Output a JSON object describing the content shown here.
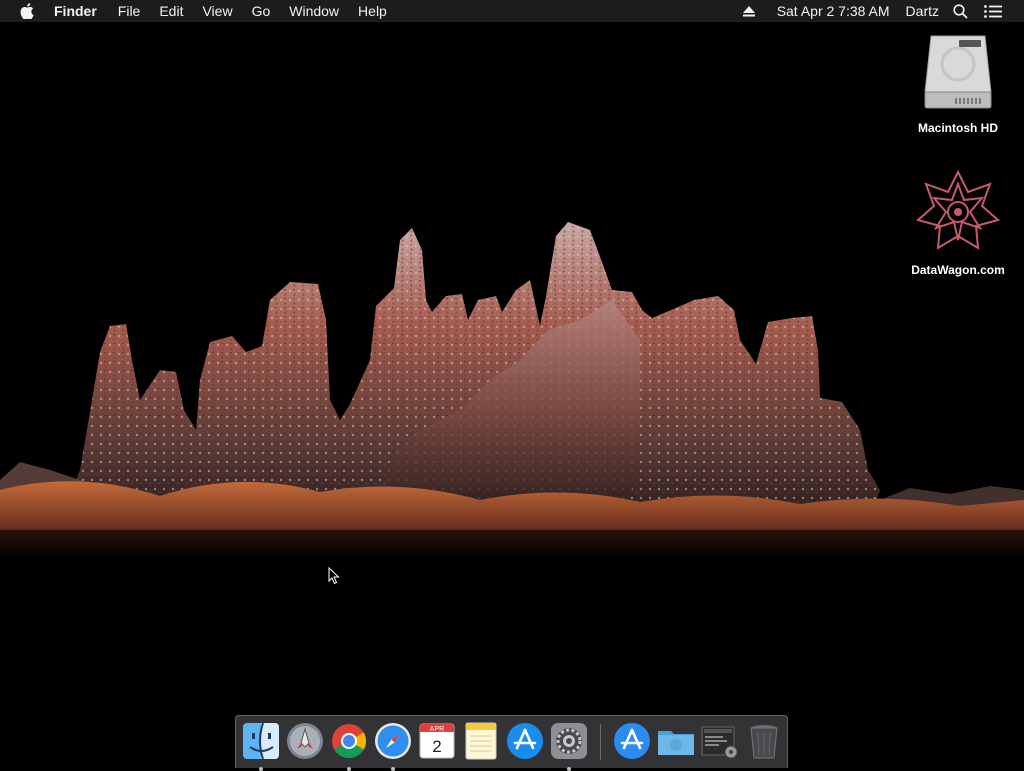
{
  "menubar": {
    "app_name": "Finder",
    "menus": [
      "File",
      "Edit",
      "View",
      "Go",
      "Window",
      "Help"
    ],
    "date_time": "Sat Apr 2  7:38 AM",
    "user": "Dartz",
    "icons": [
      "apple-icon",
      "eject-icon",
      "spotlight-search-icon",
      "notification-center-icon"
    ]
  },
  "desktop": {
    "icons": [
      {
        "label": "Macintosh HD",
        "icon": "hard-drive-icon"
      },
      {
        "label": "DataWagon.com",
        "icon": "datawagon-logo-icon"
      }
    ]
  },
  "dock": {
    "items": [
      {
        "name": "Finder",
        "icon": "finder-icon",
        "running": true
      },
      {
        "name": "Launchpad",
        "icon": "launchpad-icon",
        "running": false
      },
      {
        "name": "Google Chrome",
        "icon": "chrome-icon",
        "running": true
      },
      {
        "name": "Safari",
        "icon": "safari-icon",
        "running": true
      },
      {
        "name": "Calendar",
        "icon": "calendar-icon",
        "running": false,
        "month": "APR",
        "day": "2"
      },
      {
        "name": "Notes",
        "icon": "notes-icon",
        "running": false
      },
      {
        "name": "App Store",
        "icon": "app-store-icon",
        "running": false
      },
      {
        "name": "System Preferences",
        "icon": "system-preferences-icon",
        "running": true
      },
      {
        "name": "Applications",
        "icon": "applications-folder-icon",
        "running": false
      },
      {
        "name": "Downloads",
        "icon": "downloads-folder-icon",
        "running": false
      },
      {
        "name": "Recent Documents",
        "icon": "recent-documents-icon",
        "running": false
      },
      {
        "name": "Trash",
        "icon": "trash-icon",
        "running": false
      }
    ]
  },
  "colors": {
    "menubar_bg": "#1c1c1e",
    "desktop_bg": "#000000",
    "dock_bg": "#3a3a3c",
    "rock_red": "#9a3b2c"
  }
}
